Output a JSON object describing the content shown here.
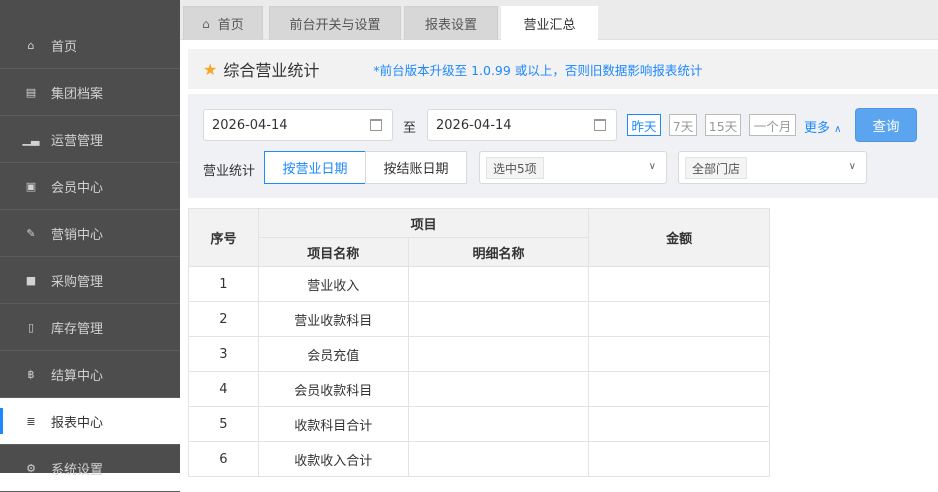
{
  "sidebar": {
    "items": [
      {
        "label": "首页",
        "icon": "home-icon"
      },
      {
        "label": "集团档案",
        "icon": "file-icon"
      },
      {
        "label": "运营管理",
        "icon": "bar-chart-icon"
      },
      {
        "label": "会员中心",
        "icon": "id-card-icon"
      },
      {
        "label": "营销中心",
        "icon": "edit-icon"
      },
      {
        "label": "采购管理",
        "icon": "book-icon"
      },
      {
        "label": "库存管理",
        "icon": "building-icon"
      },
      {
        "label": "结算中心",
        "icon": "bitcoin-icon"
      },
      {
        "label": "报表中心",
        "icon": "report-icon",
        "active": true
      },
      {
        "label": "系统设置",
        "icon": "gears-icon"
      }
    ]
  },
  "tabs": [
    {
      "label": "首页",
      "icon": "home-icon"
    },
    {
      "label": "前台开关与设置"
    },
    {
      "label": "报表设置"
    },
    {
      "label": "营业汇总",
      "active": true
    }
  ],
  "header": {
    "title": "综合营业统计",
    "notice": "*前台版本升级至 1.0.99 或以上，否则旧数据影响报表统计"
  },
  "filters": {
    "start_date": "2026-04-14",
    "to_label": "至",
    "end_date": "2026-04-14",
    "quick_ranges": [
      "昨天",
      "7天",
      "15天",
      "一个月"
    ],
    "more_label": "更多",
    "query_label": "查询",
    "stat_label": "营业统计",
    "stat_modes": [
      "按营业日期",
      "按结账日期"
    ],
    "items_select": "选中5项",
    "store_select": "全部门店"
  },
  "table": {
    "col_index": "序号",
    "col_group": "项目",
    "col_item_name": "项目名称",
    "col_detail_name": "明细名称",
    "col_amount": "金额",
    "rows": [
      {
        "index": "1",
        "item": "营业收入"
      },
      {
        "index": "2",
        "item": "营业收款科目"
      },
      {
        "index": "3",
        "item": "会员充值"
      },
      {
        "index": "4",
        "item": "会员收款科目"
      },
      {
        "index": "5",
        "item": "收款科目合计"
      },
      {
        "index": "6",
        "item": "收款收入合计"
      }
    ]
  },
  "colors": {
    "accent": "#1e88ff",
    "sidebar_bg": "#4d4d4d",
    "star": "#f5a623",
    "query_button": "#5aa4f0"
  }
}
